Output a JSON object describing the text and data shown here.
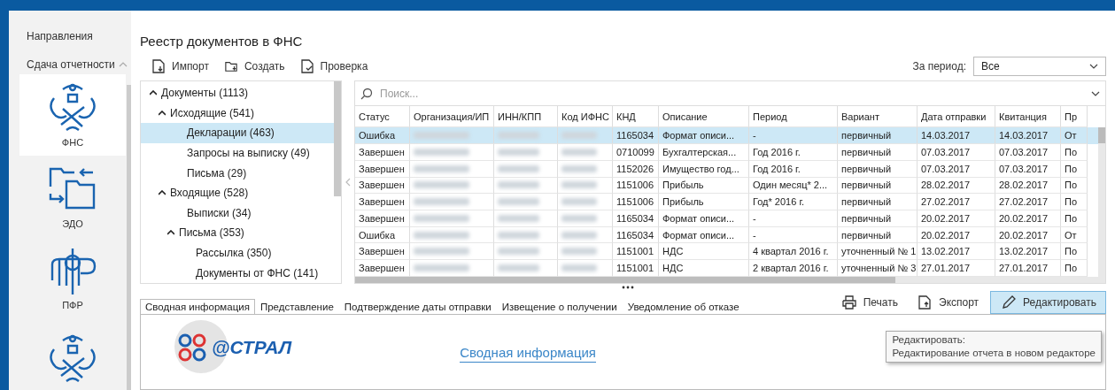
{
  "sidebar": {
    "title": "Направления",
    "section": {
      "label": "Сдача отчетности",
      "expanded": true
    },
    "items": [
      {
        "label": "ФНС",
        "selected": true,
        "kind": "eagle"
      },
      {
        "label": "ЭДО",
        "selected": false,
        "kind": "folders"
      },
      {
        "label": "ПФР",
        "selected": false,
        "kind": "pfr"
      },
      {
        "selected": false,
        "kind": "eagle"
      }
    ]
  },
  "page_title": "Реестр документов в ФНС",
  "toolbar": [
    {
      "label": "Импорт",
      "kind": "import"
    },
    {
      "label": "Создать",
      "kind": "create"
    },
    {
      "label": "Проверка",
      "kind": "check"
    }
  ],
  "period": {
    "label": "За период:",
    "value": "Все"
  },
  "tree": [
    {
      "label": "Документы (1113)",
      "expanded": true,
      "selected": false,
      "children": [
        {
          "label": "Исходящие (541)",
          "expanded": true,
          "selected": false,
          "children": [
            {
              "label": "Декларации (463)",
              "selected": true
            },
            {
              "label": "Запросы на выписку (49)",
              "selected": false
            },
            {
              "label": "Письма (29)",
              "selected": false
            }
          ]
        },
        {
          "label": "Входящие (528)",
          "expanded": true,
          "selected": false,
          "children": [
            {
              "label": "Выписки (34)",
              "selected": false
            },
            {
              "label": "Письма (353)",
              "expanded": true,
              "selected": false,
              "children": [
                {
                  "label": "Рассылка (350)",
                  "selected": false
                },
                {
                  "label": "Документы от ФНС (141)",
                  "selected": false
                }
              ]
            }
          ]
        }
      ]
    }
  ],
  "search": {
    "placeholder": "Поиск..."
  },
  "table": {
    "columns": [
      "Статус",
      "Организация/ИП",
      "ИНН/КПП",
      "Код ИФНС",
      "КНД",
      "Описание",
      "Период",
      "Вариант",
      "Дата отправки",
      "Квитанция",
      "Пр"
    ],
    "rows": [
      {
        "selected": true,
        "cells": [
          "Ошибка",
          "",
          "",
          "",
          "1165034",
          "Формат описи...",
          "-",
          "первичный",
          "14.03.2017",
          "14.03.2017",
          "От"
        ]
      },
      {
        "selected": false,
        "cells": [
          "Завершен",
          "",
          "",
          "",
          "0710099",
          "Бухгалтерская...",
          "Год 2016 г.",
          "первичный",
          "07.03.2017",
          "07.03.2017",
          "По"
        ]
      },
      {
        "selected": false,
        "cells": [
          "Завершен",
          "",
          "",
          "",
          "1152026",
          "Имущество год...",
          "Год 2016 г.",
          "первичный",
          "07.03.2017",
          "07.03.2017",
          "По"
        ]
      },
      {
        "selected": false,
        "cells": [
          "Завершен",
          "",
          "",
          "",
          "1151006",
          "Прибыль",
          "Один месяц* 2...",
          "первичный",
          "28.02.2017",
          "28.02.2017",
          "По"
        ]
      },
      {
        "selected": false,
        "cells": [
          "Завершен",
          "",
          "",
          "",
          "1151006",
          "Прибыль",
          "Год* 2016 г.",
          "первичный",
          "27.02.2017",
          "27.02.2017",
          "По"
        ]
      },
      {
        "selected": false,
        "cells": [
          "Завершен",
          "",
          "",
          "",
          "1165034",
          "Формат описи...",
          "-",
          "первичный",
          "20.02.2017",
          "20.02.2017",
          "По"
        ]
      },
      {
        "selected": false,
        "cells": [
          "Ошибка",
          "",
          "",
          "",
          "1165034",
          "Формат описи...",
          "-",
          "первичный",
          "20.02.2017",
          "20.02.2017",
          "От"
        ]
      },
      {
        "selected": false,
        "cells": [
          "Завершен",
          "",
          "",
          "",
          "1151001",
          "НДС",
          "4 квартал 2016 г.",
          "уточненный № 1",
          "13.02.2017",
          "13.02.2017",
          "По"
        ]
      },
      {
        "selected": false,
        "cells": [
          "Завершен",
          "",
          "",
          "",
          "1151001",
          "НДС",
          "2 квартал 2016 г.",
          "уточненный № 3",
          "27.01.2017",
          "27.01.2017",
          "По"
        ]
      }
    ]
  },
  "tabs": [
    {
      "label": "Сводная информация",
      "selected": true
    },
    {
      "label": "Представление",
      "selected": false
    },
    {
      "label": "Подтверждение даты отправки",
      "selected": false
    },
    {
      "label": "Извещение о получении",
      "selected": false
    },
    {
      "label": "Уведомление об отказе",
      "selected": false
    }
  ],
  "actions": [
    {
      "label": "Печать",
      "kind": "print",
      "hovered": false
    },
    {
      "label": "Экспорт",
      "kind": "export",
      "hovered": false
    },
    {
      "label": "Редактировать",
      "kind": "edit",
      "hovered": true
    }
  ],
  "tooltip": {
    "title": "Редактировать:",
    "text": "Редактирование отчета в новом редакторе"
  },
  "preview": {
    "logo": "@СТРАЛ",
    "heading": "Сводная информация"
  }
}
